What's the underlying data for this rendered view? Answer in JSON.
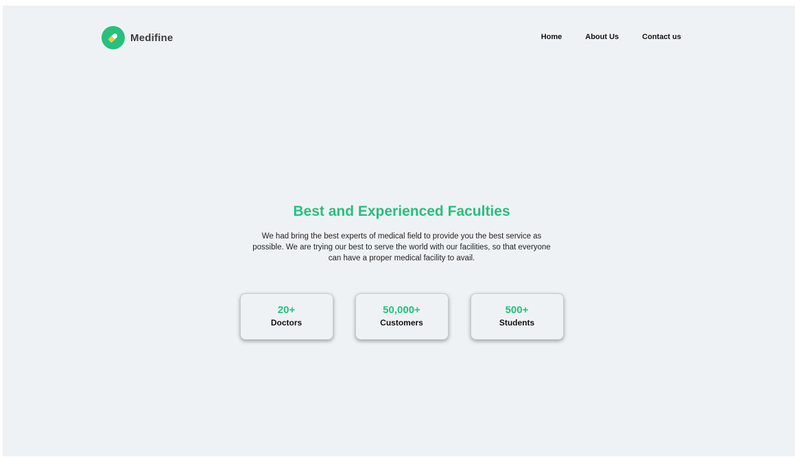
{
  "brand": {
    "name": "Medifine",
    "logo_icon": "pill-icon",
    "accent_color": "#27c07d"
  },
  "nav": {
    "items": [
      {
        "label": "Home"
      },
      {
        "label": "About Us"
      },
      {
        "label": "Contact us"
      }
    ]
  },
  "hero": {
    "title": "Best and Experienced Faculties",
    "description": "We had bring the best experts of medical field to provide you the best service as possible. We are trying our best to serve the world with our facilities, so that everyone can have a proper medical facility to avail."
  },
  "stats": [
    {
      "value": "20+",
      "label": "Doctors"
    },
    {
      "value": "50,000+",
      "label": "Customers"
    },
    {
      "value": "500+",
      "label": "Students"
    }
  ]
}
